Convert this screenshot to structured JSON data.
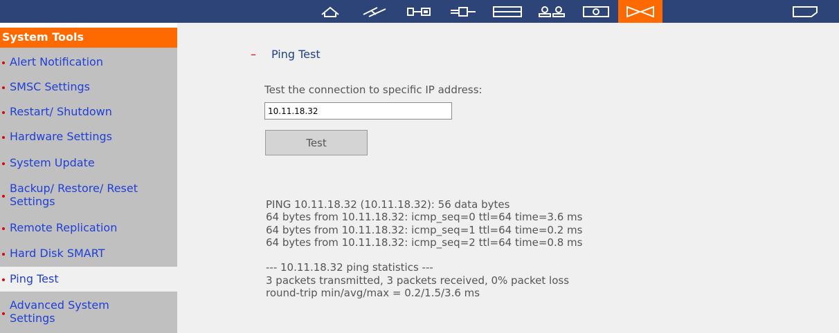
{
  "nav": {
    "icons": [
      {
        "name": "home-icon",
        "active": false
      },
      {
        "name": "quick-config-icon",
        "active": false
      },
      {
        "name": "system-settings-icon",
        "active": false
      },
      {
        "name": "network-icon",
        "active": false
      },
      {
        "name": "device-config-icon",
        "active": false
      },
      {
        "name": "user-management-icon",
        "active": false
      },
      {
        "name": "network-share-icon",
        "active": false
      },
      {
        "name": "system-tools-icon",
        "active": true
      },
      {
        "name": "logs-icon",
        "active": false
      }
    ],
    "accent_color": "#ff6a00",
    "bar_color": "#2c4478"
  },
  "sidebar": {
    "header": "System Tools",
    "items": [
      {
        "label": "Alert Notification"
      },
      {
        "label": "SMSC Settings"
      },
      {
        "label": "Restart/ Shutdown"
      },
      {
        "label": "Hardware Settings"
      },
      {
        "label": "System Update"
      },
      {
        "label": "Backup/ Restore/ Reset\nSettings"
      },
      {
        "label": "Remote Replication"
      },
      {
        "label": "Hard Disk SMART"
      },
      {
        "label": "Ping Test",
        "selected": true
      },
      {
        "label": "Advanced System\nSettings"
      }
    ]
  },
  "main": {
    "section_dash": "–",
    "section_title": "Ping Test",
    "prompt": "Test the connection to specific IP address:",
    "ip_value": "10.11.18.32",
    "test_button": "Test",
    "output": "PING 10.11.18.32 (10.11.18.32): 56 data bytes\n64 bytes from 10.11.18.32: icmp_seq=0 ttl=64 time=3.6 ms\n64 bytes from 10.11.18.32: icmp_seq=1 ttl=64 time=0.2 ms\n64 bytes from 10.11.18.32: icmp_seq=2 ttl=64 time=0.8 ms\n\n--- 10.11.18.32 ping statistics ---\n3 packets transmitted, 3 packets received, 0% packet loss\nround-trip min/avg/max = 0.2/1.5/3.6 ms"
  }
}
